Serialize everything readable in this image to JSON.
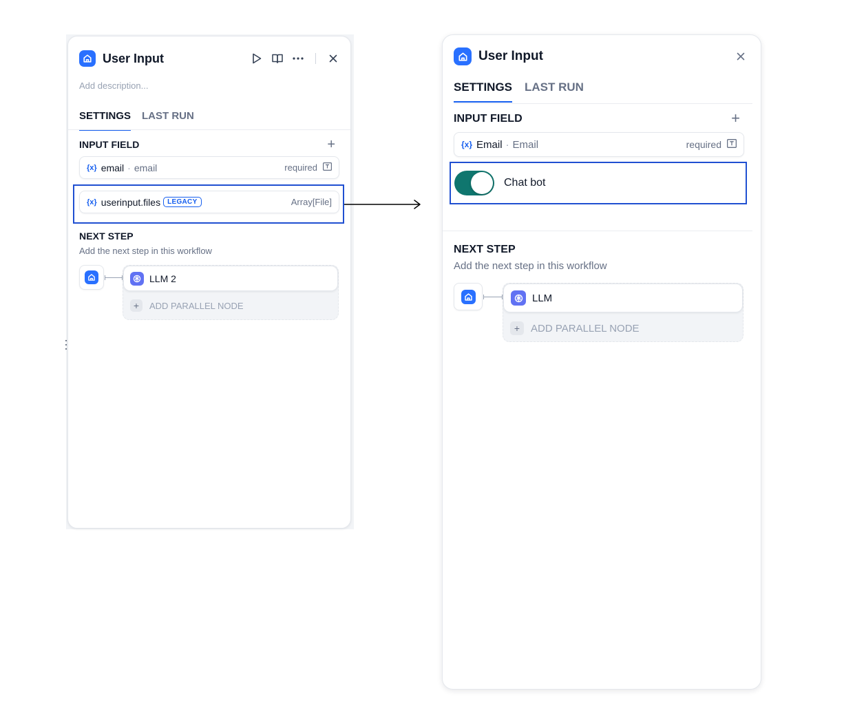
{
  "left_panel": {
    "title": "User Input",
    "description_placeholder": "Add description...",
    "icons": {
      "app": "home-icon",
      "run": "play-icon",
      "docs": "book-open-icon",
      "more": "more-horizontal-icon",
      "close": "close-icon"
    },
    "tabs": [
      {
        "label": "SETTINGS",
        "active": true
      },
      {
        "label": "LAST RUN",
        "active": false
      }
    ],
    "input_field": {
      "title": "INPUT FIELD",
      "fields": [
        {
          "var_icon": "{x}",
          "name": "email",
          "label": "email",
          "status": "required"
        },
        {
          "var_icon": "{x}",
          "name": "userinput.files",
          "badge": "LEGACY",
          "type": "Array[File]"
        }
      ]
    },
    "next_step": {
      "title": "NEXT STEP",
      "description": "Add the next step in this workflow",
      "node_label": "LLM 2",
      "add_parallel": "ADD PARALLEL NODE"
    }
  },
  "right_panel": {
    "title": "User Input",
    "tabs": [
      {
        "label": "SETTINGS",
        "active": true
      },
      {
        "label": "LAST RUN",
        "active": false
      }
    ],
    "input_field": {
      "title": "INPUT FIELD",
      "fields": [
        {
          "var_icon": "{x}",
          "name": "Email",
          "label": "Email",
          "status": "required"
        }
      ]
    },
    "toggle": {
      "label": "Chat bot",
      "on": true,
      "color": "#0f766e"
    },
    "next_step": {
      "title": "NEXT STEP",
      "description": "Add the next step in this workflow",
      "node_label": "LLM",
      "add_parallel": "ADD PARALLEL NODE"
    }
  },
  "colors": {
    "accent": "#155eef",
    "app_icon": "#2970ff",
    "llm_icon": "#6172f3",
    "highlight": "#1f4fd1"
  }
}
